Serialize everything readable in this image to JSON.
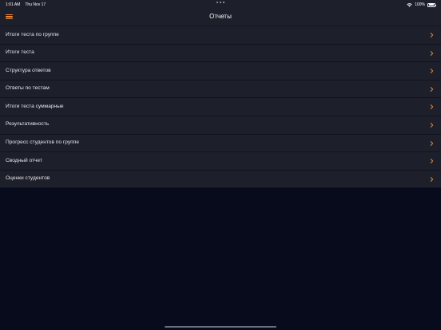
{
  "status_bar": {
    "time": "1:01 AM",
    "date": "Thu Nov 17",
    "battery": "100%"
  },
  "nav": {
    "title": "Отчеты",
    "menu_icon": "hamburger-menu-icon"
  },
  "reports": [
    {
      "label": "Итоги теста по группе"
    },
    {
      "label": "Итоги теста"
    },
    {
      "label": "Структура ответов"
    },
    {
      "label": "Ответы по тестам"
    },
    {
      "label": "Итоги теста суммарные"
    },
    {
      "label": "Результативность"
    },
    {
      "label": "Прогресс студентов по группе"
    },
    {
      "label": "Сводный отчет"
    },
    {
      "label": "Оценки студентов"
    }
  ],
  "colors": {
    "accent": "#f08a3b",
    "background": "#070b1c",
    "surface": "#1d1f2a"
  }
}
